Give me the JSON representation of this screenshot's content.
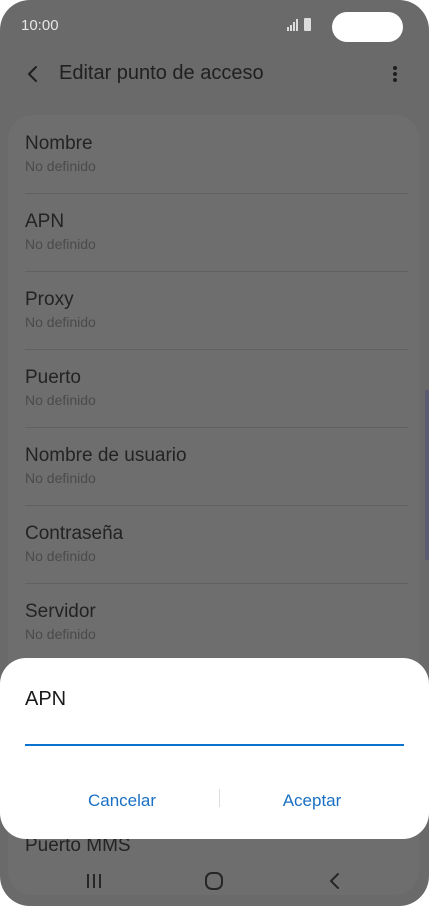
{
  "status_bar": {
    "time": "10:00"
  },
  "app_bar": {
    "title": "Editar punto de acceso"
  },
  "settings_list": [
    {
      "title": "Nombre",
      "value": "No definido"
    },
    {
      "title": "APN",
      "value": "No definido"
    },
    {
      "title": "Proxy",
      "value": "No definido"
    },
    {
      "title": "Puerto",
      "value": "No definido"
    },
    {
      "title": "Nombre de usuario",
      "value": "No definido"
    },
    {
      "title": "Contraseña",
      "value": "No definido"
    },
    {
      "title": "Servidor",
      "value": "No definido"
    }
  ],
  "partially_visible_item": {
    "title": "Puerto MMS"
  },
  "dialog": {
    "title": "APN",
    "input_value": "",
    "cancel_label": "Cancelar",
    "accept_label": "Aceptar"
  },
  "colors": {
    "accent": "#0c72d0",
    "button_text": "#1a70c4",
    "dim_overlay": "#6a6a6a",
    "dialog_background": "#ffffff"
  },
  "icons": {
    "back": "chevron-left-icon",
    "more": "more-vert-icon",
    "nav_recents": "recents-icon",
    "nav_home": "home-icon",
    "nav_back": "back-icon"
  }
}
